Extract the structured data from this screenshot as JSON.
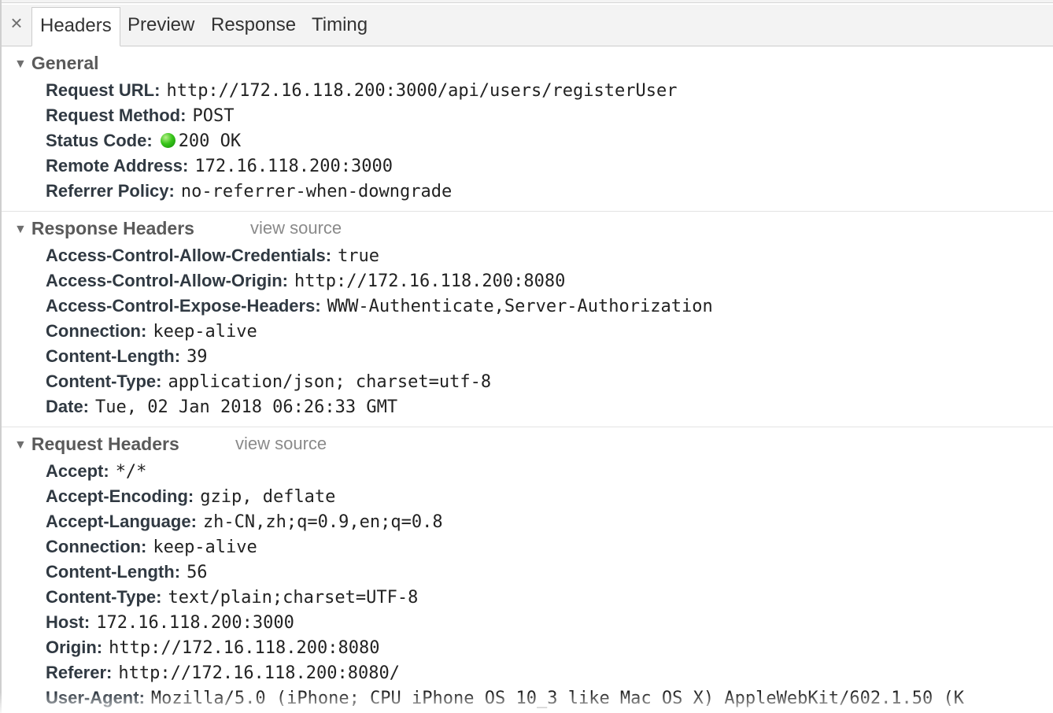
{
  "tabs": [
    {
      "label": "Headers",
      "active": true
    },
    {
      "label": "Preview",
      "active": false
    },
    {
      "label": "Response",
      "active": false
    },
    {
      "label": "Timing",
      "active": false
    }
  ],
  "icons": {
    "close": "close-icon",
    "expand": "triangle-down-icon",
    "status": "status-dot-green"
  },
  "colors": {
    "status_ok": "#2fb51a",
    "panel_bg": "#f3f3f3",
    "divider": "#e3e3e3"
  },
  "general": {
    "title": "General",
    "rows": [
      {
        "key": "Request URL:",
        "value": "http://172.16.118.200:3000/api/users/registerUser"
      },
      {
        "key": "Request Method:",
        "value": "POST"
      },
      {
        "key": "Status Code:",
        "value": "200 OK"
      },
      {
        "key": "Remote Address:",
        "value": "172.16.118.200:3000"
      },
      {
        "key": "Referrer Policy:",
        "value": "no-referrer-when-downgrade"
      }
    ]
  },
  "response_headers": {
    "title": "Response Headers",
    "view_source": "view source",
    "rows": [
      {
        "key": "Access-Control-Allow-Credentials:",
        "value": "true"
      },
      {
        "key": "Access-Control-Allow-Origin:",
        "value": "http://172.16.118.200:8080"
      },
      {
        "key": "Access-Control-Expose-Headers:",
        "value": "WWW-Authenticate,Server-Authorization"
      },
      {
        "key": "Connection:",
        "value": "keep-alive"
      },
      {
        "key": "Content-Length:",
        "value": "39"
      },
      {
        "key": "Content-Type:",
        "value": "application/json; charset=utf-8"
      },
      {
        "key": "Date:",
        "value": "Tue, 02 Jan 2018 06:26:33 GMT"
      }
    ]
  },
  "request_headers": {
    "title": "Request Headers",
    "view_source": "view source",
    "rows": [
      {
        "key": "Accept:",
        "value": "*/*"
      },
      {
        "key": "Accept-Encoding:",
        "value": "gzip, deflate"
      },
      {
        "key": "Accept-Language:",
        "value": "zh-CN,zh;q=0.9,en;q=0.8"
      },
      {
        "key": "Connection:",
        "value": "keep-alive"
      },
      {
        "key": "Content-Length:",
        "value": "56"
      },
      {
        "key": "Content-Type:",
        "value": "text/plain;charset=UTF-8"
      },
      {
        "key": "Host:",
        "value": "172.16.118.200:3000"
      },
      {
        "key": "Origin:",
        "value": "http://172.16.118.200:8080"
      },
      {
        "key": "Referer:",
        "value": "http://172.16.118.200:8080/"
      },
      {
        "key": "User-Agent:",
        "value": "Mozilla/5.0 (iPhone; CPU iPhone OS 10_3 like Mac OS X) AppleWebKit/602.1.50 (K"
      }
    ]
  }
}
